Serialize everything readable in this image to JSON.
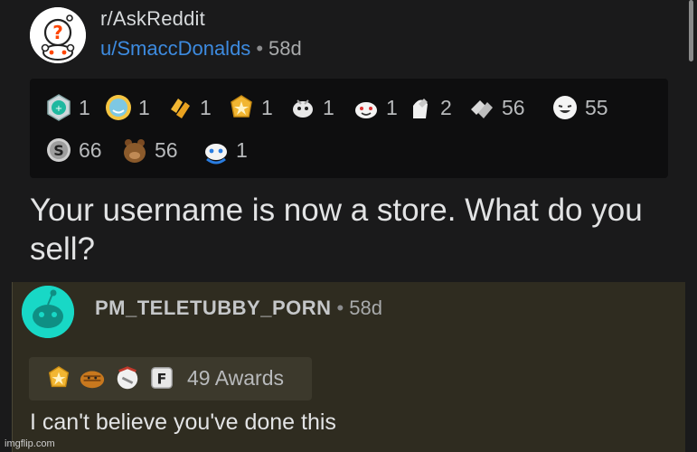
{
  "post": {
    "subreddit": "r/AskReddit",
    "author": "u/SmaccDonalds",
    "separator": "•",
    "age": "58d",
    "title": "Your username is now a store. What do you sell?",
    "awards": [
      {
        "icon": "silver-badge-icon",
        "count": "1"
      },
      {
        "icon": "sun-face-icon",
        "count": "1"
      },
      {
        "icon": "clapping-hands-icon",
        "count": "1"
      },
      {
        "icon": "gold-star-icon",
        "count": "1"
      },
      {
        "icon": "alien-face-icon",
        "count": "1"
      },
      {
        "icon": "snoo-laughing-icon",
        "count": "1"
      },
      {
        "icon": "facepalm-icon",
        "count": "2"
      },
      {
        "icon": "handshake-icon",
        "count": "56"
      },
      {
        "icon": "crying-laughing-icon",
        "count": "55"
      },
      {
        "icon": "silver-coin-icon",
        "count": "66"
      },
      {
        "icon": "bear-hug-icon",
        "count": "56"
      },
      {
        "icon": "snoo-blue-icon",
        "count": "1"
      }
    ]
  },
  "comment": {
    "author": "PM_TELETUBBY_PORN",
    "separator": "•",
    "age": "58d",
    "award_icons": [
      "gold-star-icon",
      "bread-icon",
      "facepalm-icon",
      "press-f-icon"
    ],
    "awards_label": "49 Awards",
    "body": "I can't believe you've done this"
  },
  "watermark": "imgflip.com",
  "colors": {
    "background": "#1a1a1b",
    "username": "#3d8be0",
    "comment_bg": "#2f2c20",
    "comment_avatar": "#18d8c6"
  }
}
